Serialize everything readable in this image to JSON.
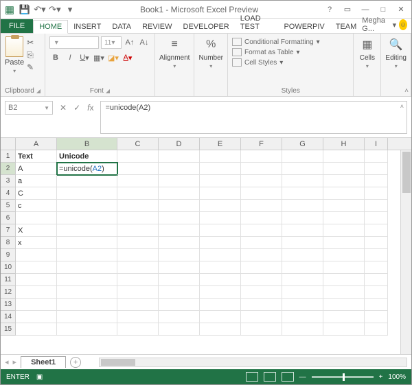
{
  "title": "Book1 - Microsoft Excel Preview",
  "user": "Megha G...",
  "tabs": {
    "file": "FILE",
    "home": "HOME",
    "insert": "INSERT",
    "data": "DATA",
    "review": "REVIEW",
    "developer": "DEVELOPER",
    "loadtest": "LOAD TEST",
    "powerpiv": "POWERPIV",
    "team": "TEAM"
  },
  "ribbon": {
    "clipboard": {
      "label": "Clipboard",
      "paste": "Paste"
    },
    "font": {
      "label": "Font",
      "size": "11"
    },
    "alignment": {
      "label": "Alignment"
    },
    "number": {
      "label": "Number"
    },
    "styles": {
      "label": "Styles",
      "cond": "Conditional Formatting",
      "table": "Format as Table",
      "cell": "Cell Styles"
    },
    "cells": {
      "label": "Cells"
    },
    "editing": {
      "label": "Editing"
    }
  },
  "namebox": "B2",
  "formula_prefix": "=unicode(",
  "formula_ref": "A2",
  "formula_suffix": ")",
  "formula_full": "=unicode(A2)",
  "columns": [
    "A",
    "B",
    "C",
    "D",
    "E",
    "F",
    "G",
    "H",
    "I"
  ],
  "headers": {
    "a": "Text",
    "b": "Unicode"
  },
  "cells": {
    "a2": "A",
    "a3": "a",
    "a4": "C",
    "a5": "c",
    "a7": "X",
    "a8": "x"
  },
  "sheet": "Sheet1",
  "status": "ENTER",
  "zoom": "100%"
}
